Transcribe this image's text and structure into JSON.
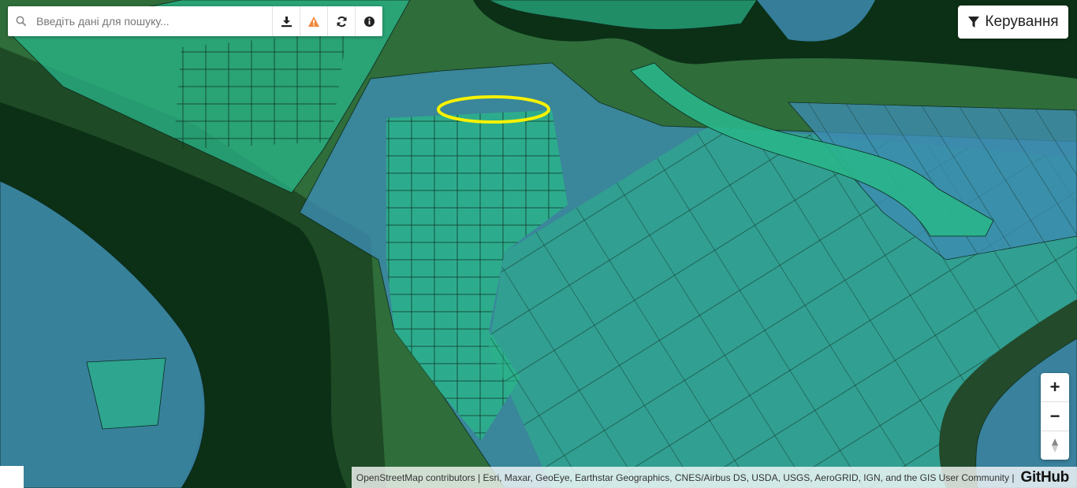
{
  "search": {
    "placeholder": "Введіть дані для пошуку...",
    "value": ""
  },
  "toolbar": {
    "icons": [
      "download-icon",
      "warning-icon",
      "refresh-icon",
      "info-icon"
    ],
    "warning_color": "#f0893b"
  },
  "control": {
    "label": "Керування",
    "icon": "filter-icon"
  },
  "zoom": {
    "in_label": "+",
    "out_label": "−",
    "north_icon": "compass-icon"
  },
  "attribution": {
    "text": "OpenStreetMap contributors | Esri, Maxar, GeoEye, Earthstar Geographics, CNES/Airbus DS, USDA, USGS, AeroGRID, IGN, and the GIS User Community |",
    "github": "GitHub"
  },
  "map": {
    "layer_colors": {
      "parcel_green": "#2ab58a",
      "parcel_blue": "#3d8bb0",
      "river": "#0b3016",
      "highlight": "#f7f200"
    }
  }
}
